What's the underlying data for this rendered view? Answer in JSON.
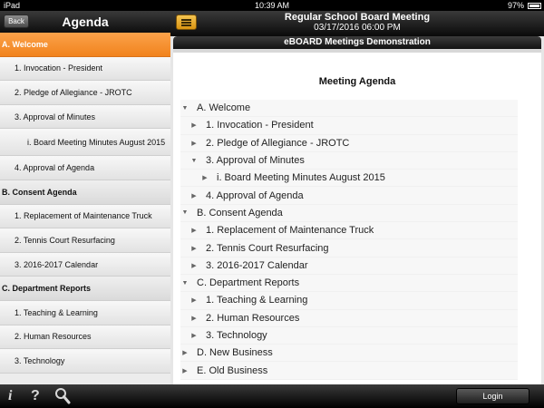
{
  "statusbar": {
    "carrier": "iPad",
    "time": "10:39 AM",
    "battery": "97%"
  },
  "sidebar": {
    "back_label": "Back",
    "title": "Agenda",
    "items": [
      {
        "label": "A. Welcome",
        "kind": "section",
        "active": true
      },
      {
        "label": "1. Invocation - President",
        "kind": "l1"
      },
      {
        "label": "2. Pledge of Allegiance - JROTC",
        "kind": "l1"
      },
      {
        "label": "3. Approval of Minutes",
        "kind": "l1"
      },
      {
        "label": "i. Board Meeting Minutes August 2015",
        "kind": "l2"
      },
      {
        "label": "4. Approval of Agenda",
        "kind": "l1"
      },
      {
        "label": "B. Consent Agenda",
        "kind": "section"
      },
      {
        "label": "1. Replacement of Maintenance Truck",
        "kind": "l1"
      },
      {
        "label": "2. Tennis Court Resurfacing",
        "kind": "l1"
      },
      {
        "label": "3. 2016-2017 Calendar",
        "kind": "l1"
      },
      {
        "label": "C. Department Reports",
        "kind": "section"
      },
      {
        "label": "1. Teaching & Learning",
        "kind": "l1"
      },
      {
        "label": "2. Human Resources",
        "kind": "l1"
      },
      {
        "label": "3. Technology",
        "kind": "l1"
      }
    ]
  },
  "header": {
    "menu_icon": "hamburger-menu-icon",
    "meeting_title": "Regular School Board Meeting",
    "meeting_date": "03/17/2016 06:00 PM"
  },
  "content": {
    "banner": "eBOARD Meetings Demonstration",
    "heading": "Meeting Agenda",
    "tree": [
      {
        "label": "A. Welcome",
        "level": 0,
        "expanded": true
      },
      {
        "label": "1. Invocation - President",
        "level": 1,
        "expanded": false
      },
      {
        "label": "2. Pledge of Allegiance - JROTC",
        "level": 1,
        "expanded": false
      },
      {
        "label": "3. Approval of Minutes",
        "level": 1,
        "expanded": true
      },
      {
        "label": "i. Board Meeting Minutes August 2015",
        "level": 2,
        "expanded": false
      },
      {
        "label": "4. Approval of Agenda",
        "level": 1,
        "expanded": false
      },
      {
        "label": "B. Consent Agenda",
        "level": 0,
        "expanded": true
      },
      {
        "label": "1. Replacement of Maintenance Truck",
        "level": 1,
        "expanded": false
      },
      {
        "label": "2. Tennis Court Resurfacing",
        "level": 1,
        "expanded": false
      },
      {
        "label": "3. 2016-2017 Calendar",
        "level": 1,
        "expanded": false
      },
      {
        "label": "C. Department Reports",
        "level": 0,
        "expanded": true
      },
      {
        "label": "1. Teaching & Learning",
        "level": 1,
        "expanded": false
      },
      {
        "label": "2. Human Resources",
        "level": 1,
        "expanded": false
      },
      {
        "label": "3. Technology",
        "level": 1,
        "expanded": false
      },
      {
        "label": "D. New Business",
        "level": 0,
        "expanded": false
      },
      {
        "label": "E. Old Business",
        "level": 0,
        "expanded": false
      }
    ]
  },
  "toolbar": {
    "icons": [
      "info-icon",
      "help-icon",
      "search-icon"
    ],
    "login_label": "Login"
  },
  "colors": {
    "accent": "#f1831d",
    "menu_button": "#e3a322",
    "bar": "#111111"
  }
}
